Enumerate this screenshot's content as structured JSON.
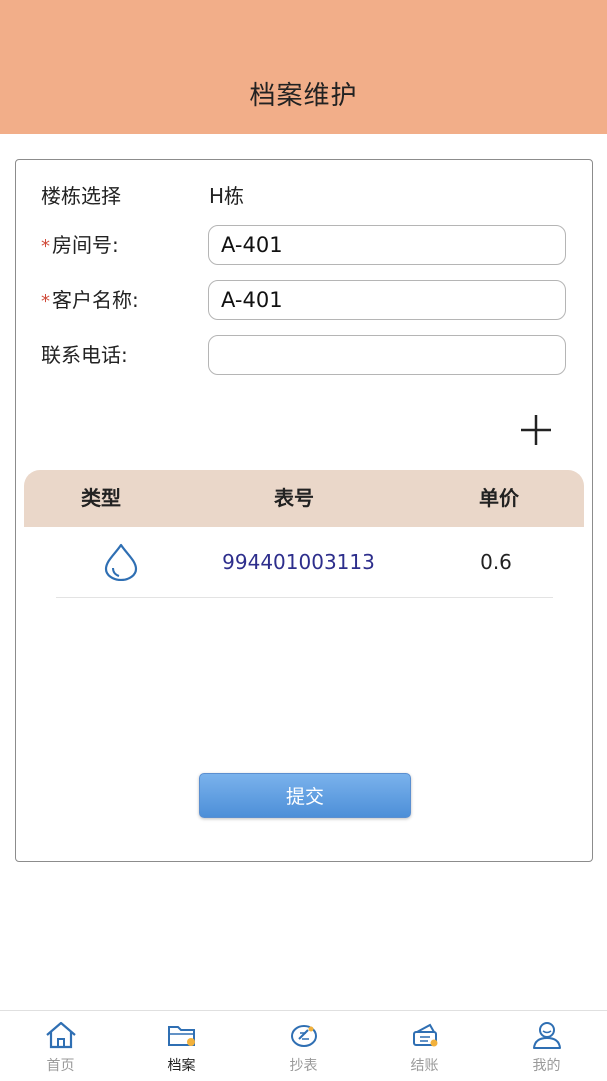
{
  "header": {
    "title": "档案维护"
  },
  "form": {
    "building": {
      "label": "楼栋选择",
      "value": "H栋"
    },
    "room": {
      "required_mark": "*",
      "label": "房间号:",
      "value": "A-401"
    },
    "customer": {
      "required_mark": "*",
      "label": "客户名称:",
      "value": "A-401"
    },
    "phone": {
      "label": "联系电话:",
      "value": ""
    }
  },
  "table": {
    "headers": {
      "type": "类型",
      "meter": "表号",
      "price": "单价"
    },
    "rows": [
      {
        "type_icon": "water-drop-icon",
        "meter": "994401003113",
        "price": "0.6"
      }
    ]
  },
  "submit_label": "提交",
  "tabbar": {
    "active": "archive",
    "items": [
      {
        "id": "home",
        "label": "首页",
        "icon": "home-icon"
      },
      {
        "id": "archive",
        "label": "档案",
        "icon": "folder-icon"
      },
      {
        "id": "reading",
        "label": "抄表",
        "icon": "meter-reading-icon"
      },
      {
        "id": "billing",
        "label": "结账",
        "icon": "money-icon"
      },
      {
        "id": "mine",
        "label": "我的",
        "icon": "user-icon"
      }
    ]
  },
  "colors": {
    "header": "#f2ae89",
    "table_header": "#ead7c9",
    "meter_number": "#2d2e8c",
    "required": "#d04b3a",
    "submit": "#5b97dd",
    "icon_blue": "#2f6fb3"
  }
}
